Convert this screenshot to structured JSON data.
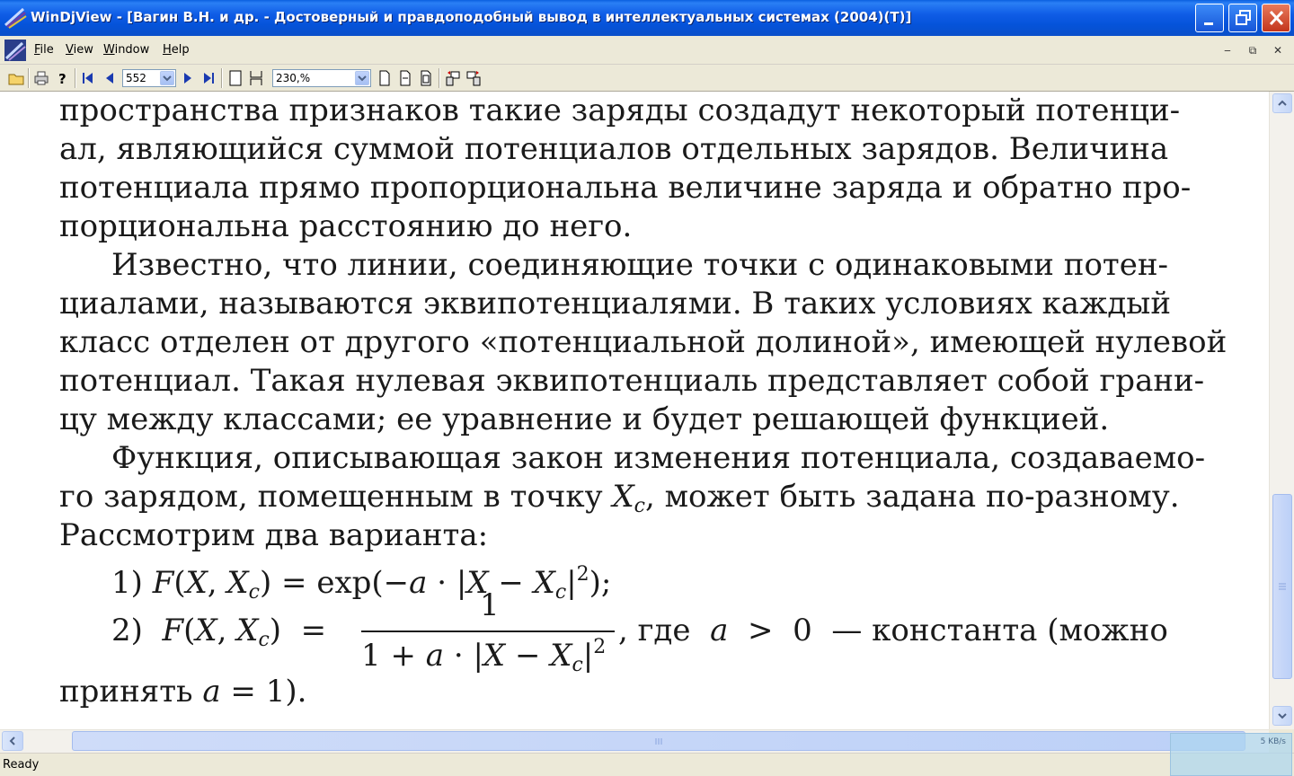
{
  "window": {
    "title": "WinDjView - [Вагин В.Н. и др. - Достоверный и правдоподобный вывод в интеллектуальных системах (2004)(Т)]"
  },
  "menu": {
    "items": [
      {
        "label_u": "F",
        "label_rest": "ile"
      },
      {
        "label_u": "V",
        "label_rest": "iew"
      },
      {
        "label_u": "W",
        "label_rest": "indow"
      },
      {
        "label_u": "H",
        "label_rest": "elp"
      }
    ]
  },
  "toolbar": {
    "page_number": "552",
    "zoom": "230,%"
  },
  "document": {
    "lines": [
      "пространства признаков такие заряды создадут некоторый потенци-",
      "ал, являющийся суммой потенциалов отдельных зарядов. Величина",
      "потенциала прямо пропорциональна величине заряда и обратно про-",
      "порциональна расстоянию до него.",
      "Известно, что линии, соединяющие точки с одинаковыми потен-",
      "циалами, называются эквипотенциалями. В таких условиях каждый",
      "класс отделен от другого «потенциальной долиной», имеющей нулевой",
      "потенциал. Такая нулевая эквипотенциаль представляет собой грани-",
      "цу между классами; ее уравнение и будет решающей функцией.",
      "Функция, описывающая закон изменения потенциала, создаваемо-",
      "го зарядом, помещенным в точку",
      ", может быть задана по-разному.",
      "Рассмотрим два варианта:"
    ],
    "formula1_label": "1)",
    "formula2_label": "2)",
    "formula2_tail": ", где",
    "formula2_tail2": "— константа (можно",
    "last_line_start": "принять",
    "last_line_end": ")."
  },
  "status": {
    "text": "Ready",
    "net_rate": "5 KB/s"
  }
}
